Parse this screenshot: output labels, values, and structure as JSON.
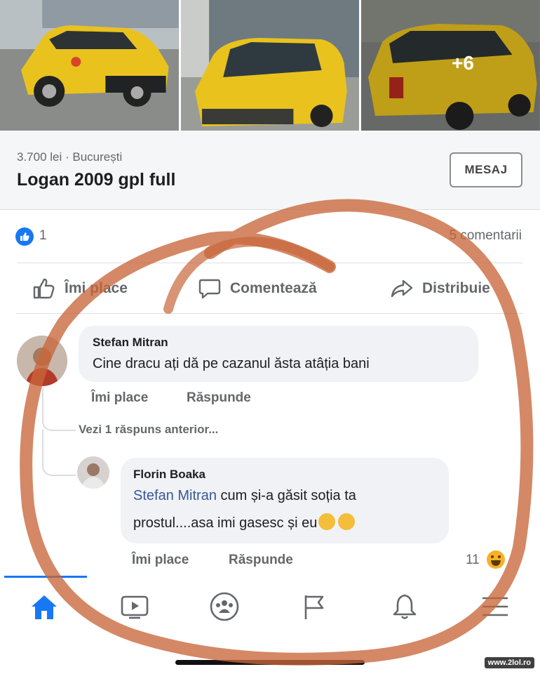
{
  "gallery": {
    "more_count": "+6"
  },
  "listing": {
    "price_location": "3.700 lei · București",
    "title": "Logan 2009 gpl full",
    "message_button": "MESAJ"
  },
  "reactions": {
    "like_count": "1",
    "comments_count": "5 comentarii"
  },
  "actions": {
    "like": "Îmi place",
    "comment": "Comentează",
    "share": "Distribuie"
  },
  "comments": [
    {
      "author": "Stefan Mitran",
      "text": "Cine dracu ați dă pe cazanul ăsta atâția bani",
      "like_label": "Îmi place",
      "reply_label": "Răspunde"
    }
  ],
  "previous_replies": "Vezi 1 răspuns anterior...",
  "reply": {
    "author": "Florin Boaka",
    "mention": "Stefan Mitran",
    "text_line1": " cum și-a găsit soția ta",
    "text_line2": "prostul....asa imi gasesc și eu",
    "like_label": "Îmi place",
    "reply_label": "Răspunde",
    "reaction_count": "11"
  },
  "watermark": "www.2lol.ro",
  "colors": {
    "brand_blue": "#1877f2",
    "taxi_yellow": "#e9c21e",
    "marker_orange": "#c8663a"
  },
  "icons": [
    "thumbs-up-icon",
    "comment-icon",
    "share-icon",
    "home-icon",
    "video-icon",
    "groups-icon",
    "flag-icon",
    "bell-icon",
    "menu-icon"
  ]
}
